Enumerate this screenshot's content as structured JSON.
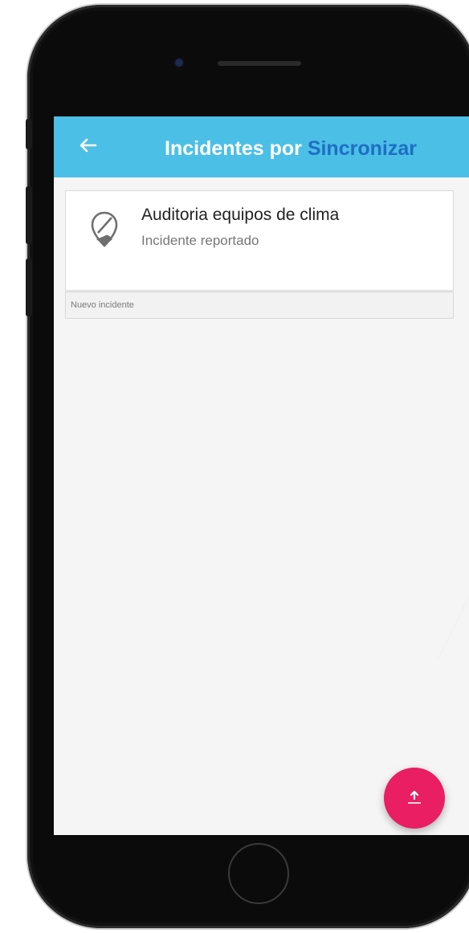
{
  "app": {
    "title_main": "Incidentes por ",
    "title_accent": "Sincronizar"
  },
  "colors": {
    "appbar": "#4cbfe6",
    "title_accent": "#1e6fc4",
    "fab": "#e91e63"
  },
  "icons": {
    "back": "arrow-left-icon",
    "item": "map-pin-off-icon",
    "fab": "upload-icon"
  },
  "list": {
    "items": [
      {
        "title": "Auditoria equipos de clima",
        "subtitle": "Incidente reportado"
      }
    ],
    "footer": "Nuevo incidente"
  }
}
